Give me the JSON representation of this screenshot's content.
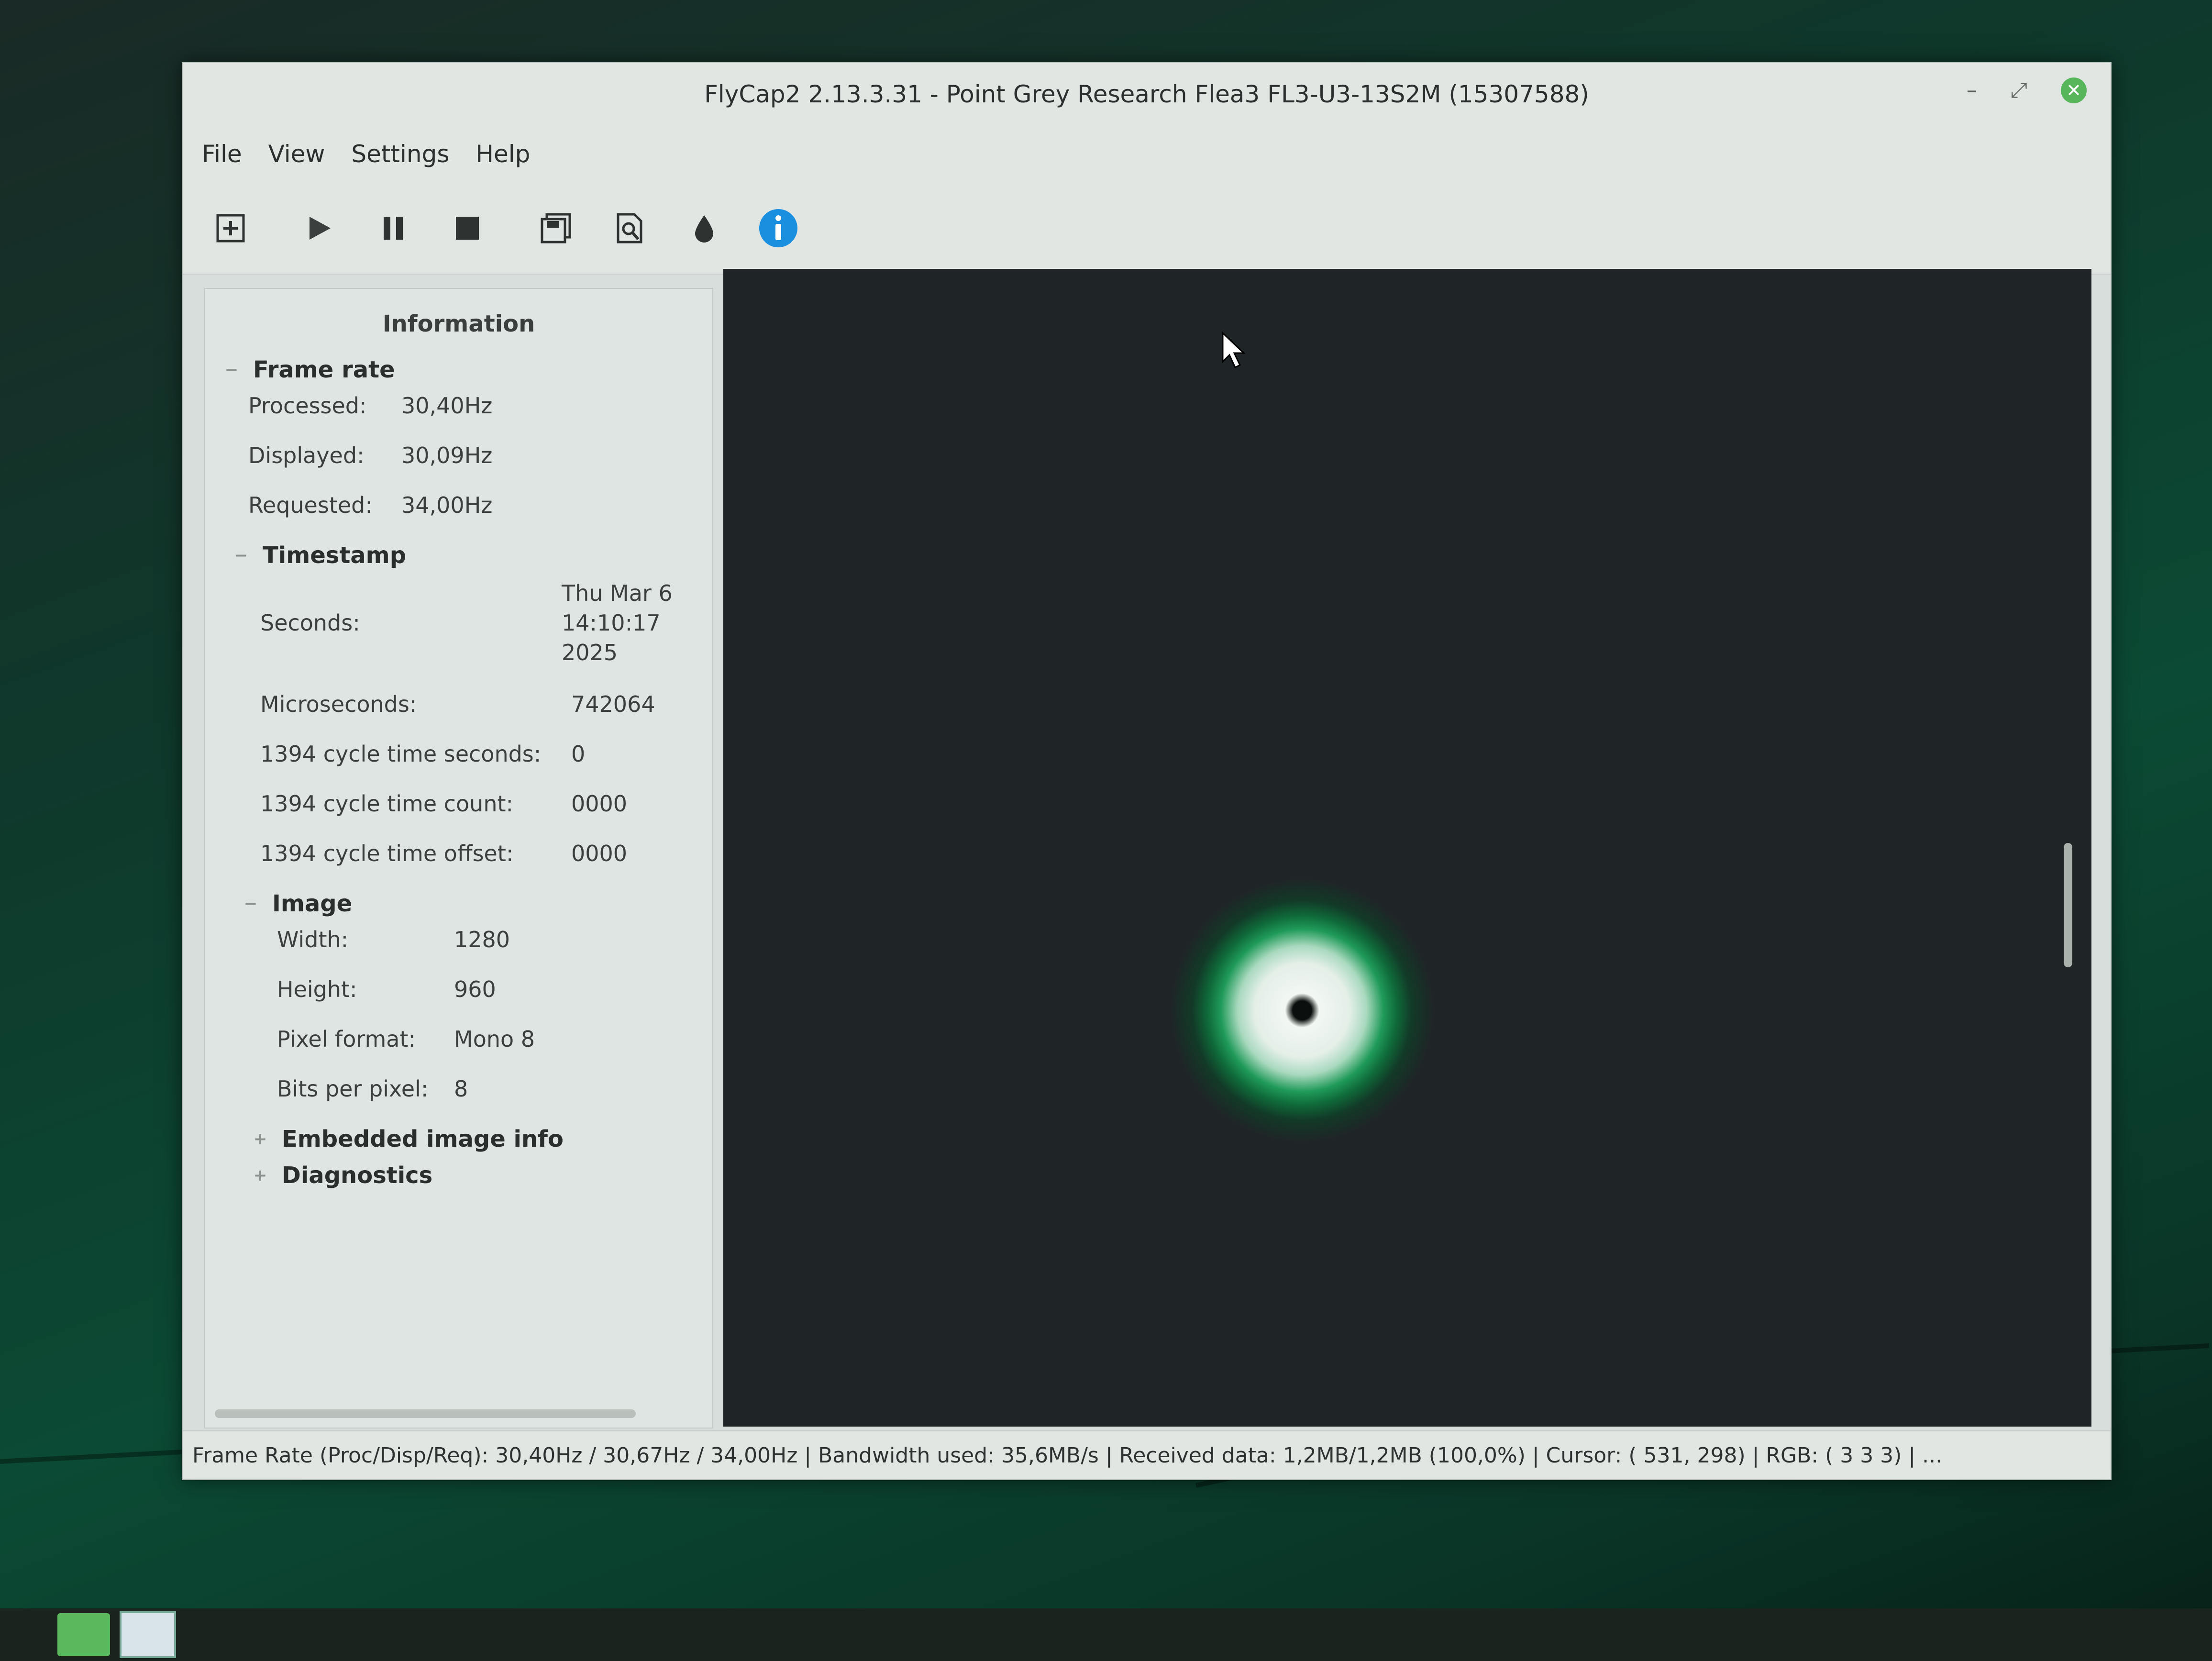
{
  "window": {
    "title": "FlyCap2 2.13.3.31 - Point Grey Research Flea3 FL3-U3-13S2M (15307588)"
  },
  "menu": [
    "File",
    "View",
    "Settings",
    "Help"
  ],
  "toolbar": {
    "icons": [
      "new-camera-icon",
      "play-icon",
      "pause-icon",
      "stop-icon",
      "save-icon",
      "record-icon",
      "color-icon",
      "info-icon"
    ],
    "accent": "#1a8fe0"
  },
  "info": {
    "title": "Information",
    "frame_rate": {
      "label": "Frame rate",
      "processed_label": "Processed:",
      "processed": "30,40Hz",
      "displayed_label": "Displayed:",
      "displayed": "30,09Hz",
      "requested_label": "Requested:",
      "requested": "34,00Hz"
    },
    "timestamp": {
      "label": "Timestamp",
      "seconds_label": "Seconds:",
      "seconds_line1": "Thu Mar  6",
      "seconds_line2": "14:10:17",
      "seconds_line3": "2025",
      "microseconds_label": "Microseconds:",
      "microseconds": "742064",
      "cycle_seconds_label": "1394 cycle time seconds:",
      "cycle_seconds": "0",
      "cycle_count_label": "1394 cycle time count:",
      "cycle_count": "0000",
      "cycle_offset_label": "1394 cycle time offset:",
      "cycle_offset": "0000"
    },
    "image": {
      "label": "Image",
      "width_label": "Width:",
      "width": "1280",
      "height_label": "Height:",
      "height": "960",
      "pixel_format_label": "Pixel format:",
      "pixel_format": "Mono 8",
      "bpp_label": "Bits per pixel:",
      "bpp": "8"
    },
    "embedded": {
      "label": "Embedded image info"
    },
    "diagnostics": {
      "label": "Diagnostics"
    }
  },
  "status": {
    "text": "Frame Rate (Proc/Disp/Req): 30,40Hz / 30,67Hz / 34,00Hz | Bandwidth used: 35,6MB/s | Received data: 1,2MB/1,2MB (100,0%) | Cursor: ( 531,  298) | RGB: ( 3   3   3) | ..."
  }
}
